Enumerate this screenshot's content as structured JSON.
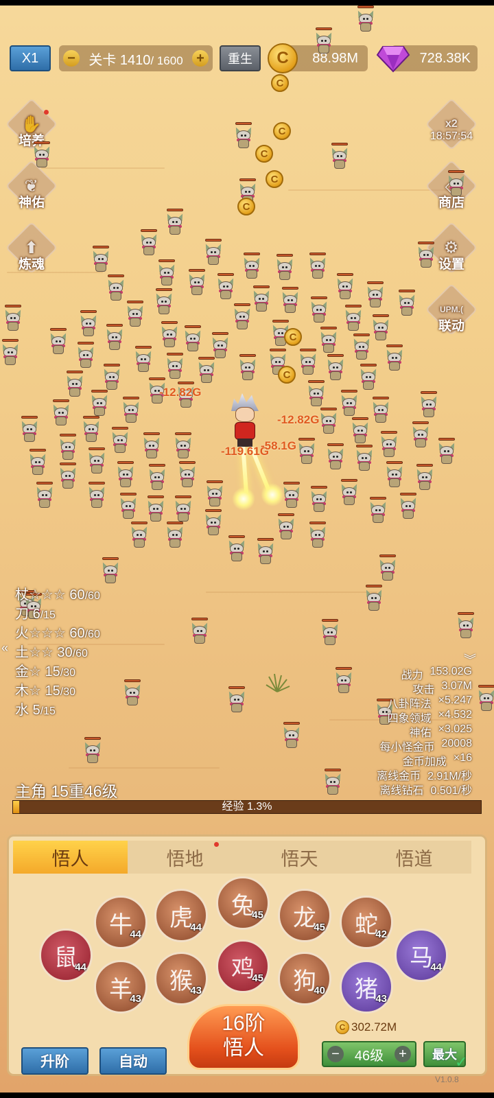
{
  "top_bar": {
    "speed": "X1",
    "level_prefix": "关卡",
    "level_current": "1410",
    "level_total": "/ 1600",
    "minus": "−",
    "plus": "+",
    "rebirth": "重生",
    "gold": "88.98M",
    "diamonds": "728.38K",
    "coin_symbol": "C"
  },
  "side_left": [
    {
      "label": "培养",
      "icon": "hand-icon"
    },
    {
      "label": "神佑",
      "icon": "wings-icon"
    },
    {
      "label": "炼魂",
      "icon": "up-arrow-icon"
    }
  ],
  "side_right": {
    "boost_label": "x2",
    "timer": "18:57:54",
    "shop": "商店",
    "settings": "设置",
    "link": "联动",
    "link_icon_text": "UPM.("
  },
  "damage_numbers": [
    "-12.82G",
    "-12.82G",
    "-119.61G",
    "-58.1G"
  ],
  "weapons": [
    {
      "name": "杖",
      "stars": "☆☆☆",
      "cur": "60",
      "max": "/60"
    },
    {
      "name": "刀",
      "stars": "",
      "cur": "6",
      "max": "/15"
    },
    {
      "name": "火",
      "stars": "☆☆☆",
      "cur": "60",
      "max": "/60"
    },
    {
      "name": "土",
      "stars": "☆☆",
      "cur": "30",
      "max": "/60"
    },
    {
      "name": "金",
      "stars": "☆",
      "cur": "15",
      "max": "/30"
    },
    {
      "name": "木",
      "stars": "☆",
      "cur": "15",
      "max": "/30"
    },
    {
      "name": "水",
      "stars": "",
      "cur": "5",
      "max": "/15"
    }
  ],
  "stats": [
    {
      "k": "战力",
      "v": "153.02G"
    },
    {
      "k": "攻击",
      "v": "3.07M"
    },
    {
      "k": "八卦阵法",
      "v": "×5.247"
    },
    {
      "k": "四象领域",
      "v": "×4.532"
    },
    {
      "k": "神佑",
      "v": "×3.025"
    },
    {
      "k": "每小怪金币",
      "v": "20008"
    },
    {
      "k": "金币加成",
      "v": "×16"
    },
    {
      "k": "离线金币",
      "v": "2.91M/秒"
    },
    {
      "k": "离线钻石",
      "v": "0.501/秒"
    }
  ],
  "hero": {
    "name": "主角",
    "rank": "15重46级"
  },
  "exp": {
    "label": "经验 1.3%",
    "percent": 1.3
  },
  "tabs": [
    "悟人",
    "悟地",
    "悟天",
    "悟道"
  ],
  "zodiac": [
    {
      "name": "rat",
      "glyph": "鼠",
      "level": "44",
      "style": "z-red"
    },
    {
      "name": "ox",
      "glyph": "牛",
      "level": "44",
      "style": "z-brown"
    },
    {
      "name": "goat",
      "glyph": "羊",
      "level": "43",
      "style": "z-brown"
    },
    {
      "name": "tiger",
      "glyph": "虎",
      "level": "44",
      "style": "z-brown"
    },
    {
      "name": "monkey",
      "glyph": "猴",
      "level": "43",
      "style": "z-brown"
    },
    {
      "name": "rabbit",
      "glyph": "兔",
      "level": "45",
      "style": "z-brown"
    },
    {
      "name": "rooster",
      "glyph": "鸡",
      "level": "45",
      "style": "z-red"
    },
    {
      "name": "dragon",
      "glyph": "龙",
      "level": "45",
      "style": "z-brown"
    },
    {
      "name": "dog",
      "glyph": "狗",
      "level": "40",
      "style": "z-brown"
    },
    {
      "name": "snake",
      "glyph": "蛇",
      "level": "42",
      "style": "z-brown"
    },
    {
      "name": "pig",
      "glyph": "猪",
      "level": "43",
      "style": "z-purple"
    },
    {
      "name": "horse",
      "glyph": "马",
      "level": "44",
      "style": "z-purple"
    }
  ],
  "bottom": {
    "upgrade": "升阶",
    "auto": "自动",
    "tier_line1": "16阶",
    "tier_line2": "悟人",
    "cost": "302.72M",
    "level_minus": "−",
    "level_value": "46级",
    "level_plus": "+",
    "max": "最大",
    "version": "V1.0.8"
  }
}
